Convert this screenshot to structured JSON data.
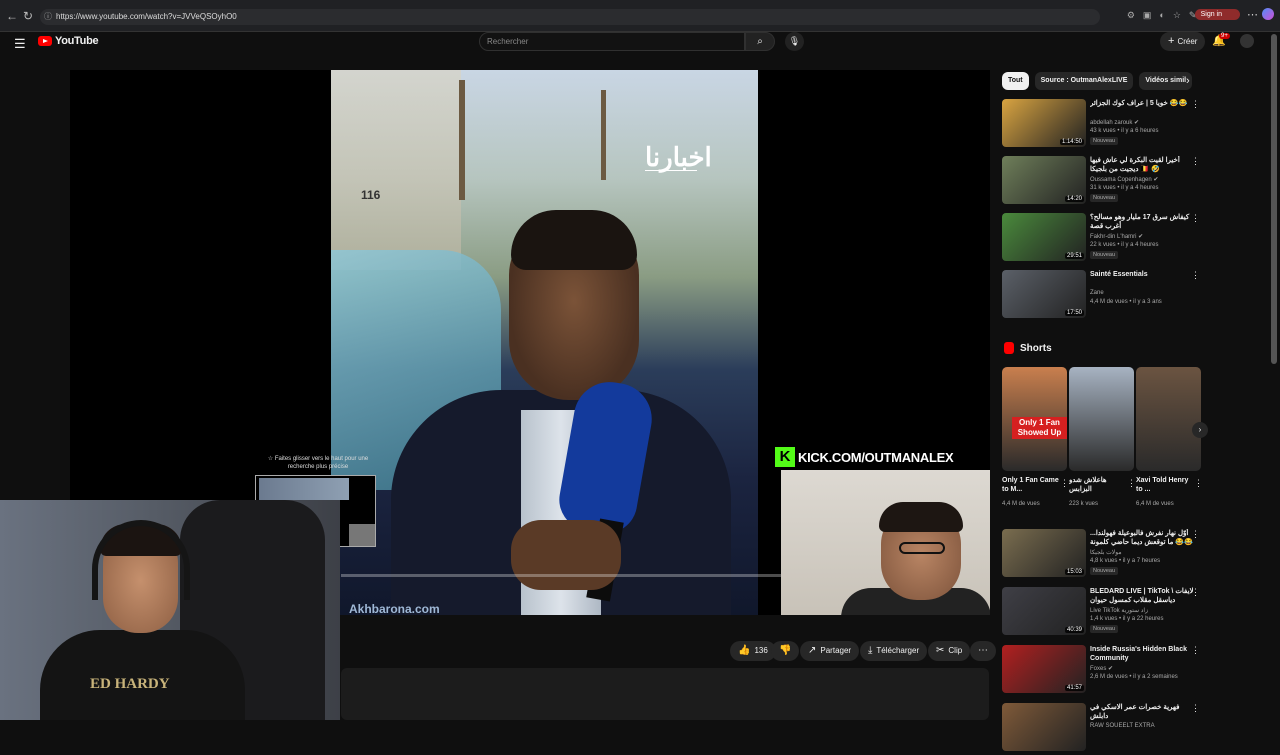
{
  "browser": {
    "url": "https://www.youtube.com/watch?v=JVVeQSOyhO0",
    "signin_label": "Sign in"
  },
  "header": {
    "logo_text": "YouTube",
    "search_placeholder": "Rechercher",
    "create_label": "Créer",
    "notif_count": "9+"
  },
  "player": {
    "watermark": "اخبارنا",
    "bottom_watermark": "Akhbarona.com",
    "plate": "116",
    "hint_text": "☆ Faites glisser vers le haut pour une recherche plus précise",
    "kick_text": "KICK.COM/OUTMANALEX"
  },
  "actions": {
    "like_count": "136",
    "share_label": "Partager",
    "download_label": "Télécharger",
    "clip_label": "Clip"
  },
  "chips": [
    {
      "label": "Tout",
      "active": true
    },
    {
      "label": "Source : OutmanAlexLIVE",
      "active": false
    },
    {
      "label": "Vidéos simil",
      "active": false
    }
  ],
  "recommendations": [
    {
      "title": "خويا 5 | عراف كوك الجزائر 😂😂",
      "channel": "abdellah zarouk ✔",
      "meta": "43 k vues • il y a 6 heures",
      "badge": "Nouveau",
      "duration": "1:14:50",
      "color": "#d9a441"
    },
    {
      "title": "أخيرا لقيت البكرة لي عاش فيها ديجيت من بلجيكا 🇧🇪 🤣",
      "channel": "Oussama Copenhagen ✔",
      "meta": "31 k vues • il y a 4 heures",
      "badge": "Nouveau",
      "duration": "14:20",
      "color": "#6f7f5a"
    },
    {
      "title": "كيفاش سرق 17 مليار وهو مسالح؟ أغرب قصة",
      "channel": "Fakhr-din L'hamri ✔",
      "meta": "22 k vues • il y a 4 heures",
      "badge": "Nouveau",
      "duration": "29:51",
      "color": "#4a8a3c"
    },
    {
      "title": "Sainté Essentials",
      "channel": "Zane",
      "meta": "4,4 M de vues • il y a 3 ans",
      "badge": "",
      "duration": "17:50",
      "color": "#5b6068"
    }
  ],
  "shorts": {
    "heading": "Shorts",
    "items": [
      {
        "title": "Only 1 Fan Came to M...",
        "views": "4,4 M de vues",
        "overlay": "Only 1 Fan Showed Up",
        "color": "#c97f4e"
      },
      {
        "title": "هاعلاش شدو البزابس",
        "views": "223 k vues",
        "overlay": "",
        "color": "#a7b3c2"
      },
      {
        "title": "Xavi Told Henry to ...",
        "views": "6,4 M de vues",
        "overlay": "",
        "color": "#6b5441"
      }
    ]
  },
  "recommendations2": [
    {
      "title": "أوّل نهار نفرش فالبوعيلة فهولندا... ما توقعش ديما حاضي كلمونة 😂😂",
      "channel": "مولات بلجيكا",
      "meta": "4,8 k vues • il y a 7 heures",
      "badge": "Nouveau",
      "duration": "15:03",
      "color": "#7a6d4f"
    },
    {
      "title": "BLEDARD LIVE | TikTok \\ لايفات دياسقل مقلاب كمسول حيوان",
      "channel": "Live TikTok زاد ستورية",
      "meta": "1,4 k vues • il y a 22 heures",
      "badge": "Nouveau",
      "duration": "40:39",
      "color": "#3f3f46"
    },
    {
      "title": "Inside Russia's Hidden Black Community",
      "channel": "Foxes ✔",
      "meta": "2,6 M de vues • il y a 2 semaines",
      "badge": "",
      "duration": "41:57",
      "color": "#b22020"
    },
    {
      "title": "فهرية خصرات عمر الاسكي في دابلش",
      "channel": "RAW SOUEELT EXTRA",
      "meta": "",
      "badge": "",
      "duration": "",
      "color": "#7f5a39"
    }
  ]
}
